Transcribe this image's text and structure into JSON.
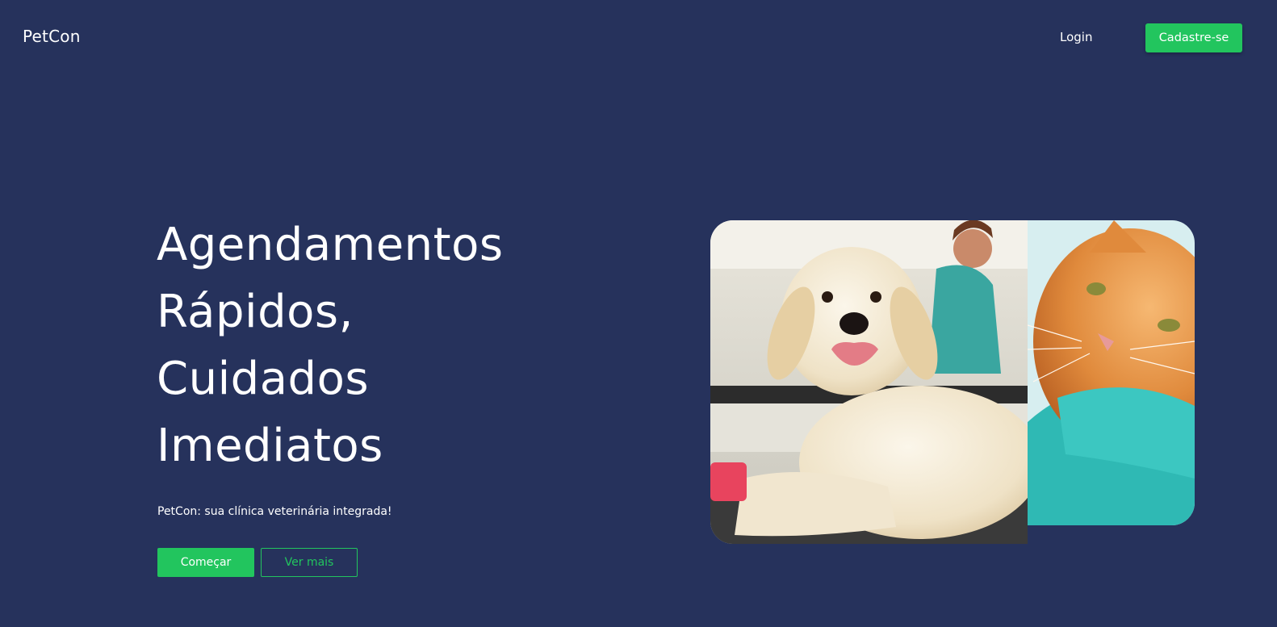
{
  "header": {
    "brand": "PetCon",
    "login_label": "Login",
    "signup_label": "Cadastre-se"
  },
  "hero": {
    "title_lines": [
      "Agendamentos",
      "Rápidos,",
      "Cuidados",
      "Imediatos"
    ],
    "tagline": "PetCon: sua clínica veterinária integrada!",
    "start_label": "Começar",
    "more_label": "Ver mais"
  },
  "colors": {
    "background": "#26325c",
    "accent": "#22c55e",
    "text": "#ffffff"
  },
  "images": {
    "hero_photo": "dog-and-cat-vet-photo"
  }
}
